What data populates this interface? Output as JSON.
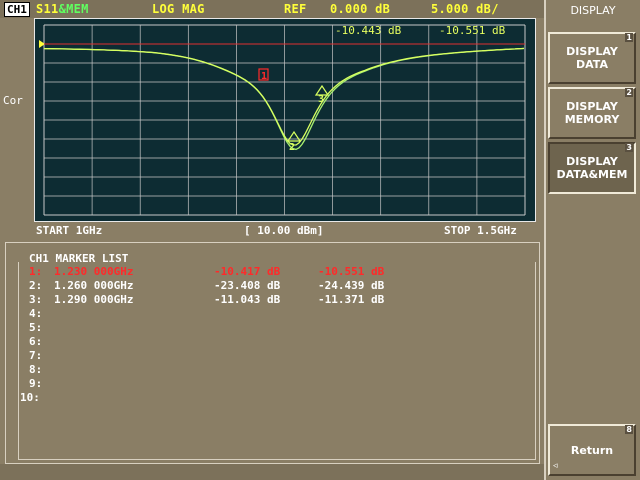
{
  "header": {
    "channel": "CH1",
    "measurement": "S11",
    "memory_suffix": "&MEM",
    "format": "LOG MAG",
    "ref_label": "REF",
    "ref_value": "0.000 dB",
    "scale": "5.000 dB/",
    "readout_data": "-10.443 dB",
    "readout_mem": "-10.551 dB"
  },
  "side": {
    "cor_label": "Cor"
  },
  "plot": {
    "start": "START 1GHz",
    "power": "[ 10.00 dBm]",
    "stop": "STOP 1.5GHz",
    "marker_flag": "1"
  },
  "marker_list": {
    "title": "CH1 MARKER LIST",
    "rows": [
      {
        "num": "1:",
        "freq": "1.230 000GHz",
        "data": "-10.417 dB",
        "mem": "-10.551 dB"
      },
      {
        "num": "2:",
        "freq": "1.260 000GHz",
        "data": "-23.408 dB",
        "mem": "-24.439 dB"
      },
      {
        "num": "3:",
        "freq": "1.290 000GHz",
        "data": "-11.043 dB",
        "mem": "-11.371 dB"
      },
      {
        "num": "4:",
        "freq": "",
        "data": "",
        "mem": ""
      },
      {
        "num": "5:",
        "freq": "",
        "data": "",
        "mem": ""
      },
      {
        "num": "6:",
        "freq": "",
        "data": "",
        "mem": ""
      },
      {
        "num": "7:",
        "freq": "",
        "data": "",
        "mem": ""
      },
      {
        "num": "8:",
        "freq": "",
        "data": "",
        "mem": ""
      },
      {
        "num": "9:",
        "freq": "",
        "data": "",
        "mem": ""
      },
      {
        "num": "10:",
        "freq": "",
        "data": "",
        "mem": ""
      }
    ],
    "active_row": 1
  },
  "softkeys": {
    "title": "DISPLAY",
    "items": [
      {
        "label": "DISPLAY\nDATA",
        "num": "1"
      },
      {
        "label": "DISPLAY\nMEMORY",
        "num": "2"
      },
      {
        "label": "DISPLAY\nDATA&MEM",
        "num": "3"
      }
    ],
    "selected": 3,
    "return_label": "Return",
    "return_num": "8"
  },
  "colors": {
    "trace": "#d8ff60",
    "memory_trace": "#a8f070",
    "grid": "#c8c8c8",
    "ref_line": "#e03030",
    "active_marker": "#ff2a2a",
    "header_text": "#ffff3a"
  },
  "icons": {
    "ref_pointer": "ref-pointer-icon",
    "return_corner": "corner-arrow-icon"
  }
}
